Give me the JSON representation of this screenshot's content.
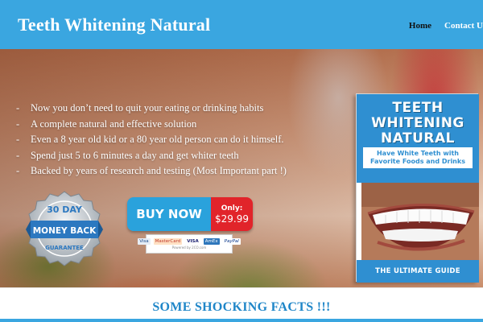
{
  "header": {
    "site_title": "Teeth Whitening Natural",
    "nav": [
      {
        "label": "Home",
        "active": true
      },
      {
        "label": "Contact U"
      }
    ],
    "colors": {
      "bar": "#3aa6e0",
      "active_link": "#111111"
    }
  },
  "hero": {
    "bullets": [
      "Now you don’t need to quit your eating or drinking habits",
      "A complete natural and effective solution",
      "Even a 8 year old kid or a 80 year old person can do it himself.",
      "Spend just 5 to 6 minutes a day and get whiter teeth",
      "Backed by years of research and testing (Most Important part !)"
    ],
    "bullet_marker": "-",
    "badge": {
      "top": "30 DAY",
      "middle": "MONEY BACK",
      "bottom": "GUARANTEE"
    },
    "buy_button": {
      "label": "BUY NOW",
      "price_prefix": "Only:",
      "price": "$29.99",
      "colors": {
        "main": "#2aa2dc",
        "price": "#e1242a"
      }
    },
    "payment": {
      "methods": [
        "Visa",
        "MasterCard",
        "VISA",
        "AmEx",
        "PayPal"
      ],
      "note": "Powered by 2CO.com"
    }
  },
  "book": {
    "title": "TEETH WHITENING NATURAL",
    "subtitle": "Have White Teeth with Favorite Foods and Drinks",
    "footer": "THE ULTIMATE GUIDE",
    "color": "#2f8fd1"
  },
  "facts": {
    "heading": "SOME SHOCKING FACTS !!!",
    "color": "#1f86c8"
  }
}
